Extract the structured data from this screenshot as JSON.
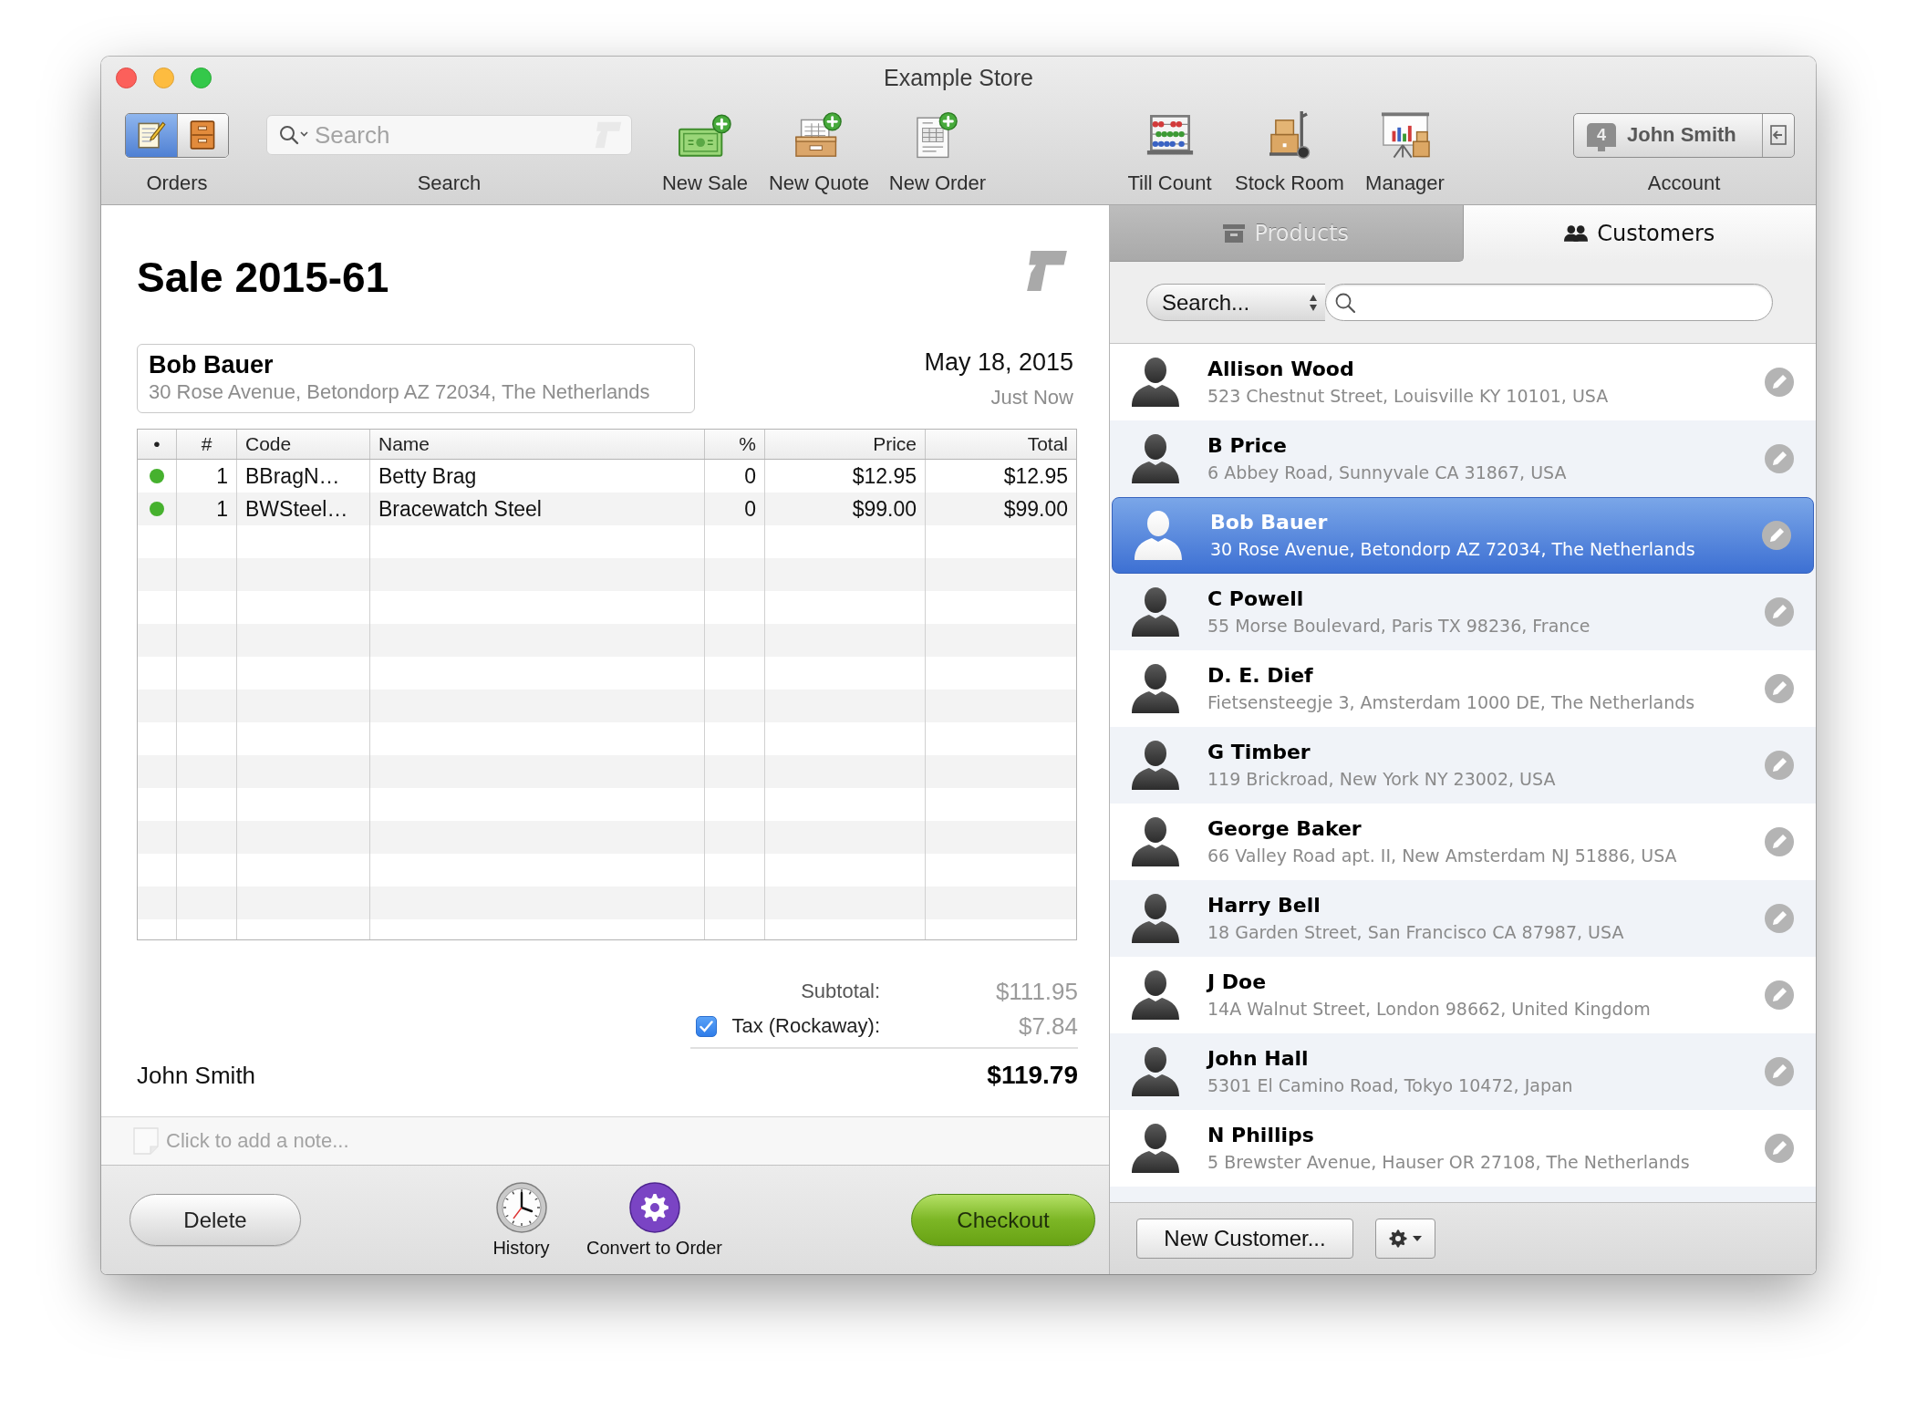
{
  "window": {
    "title": "Example Store"
  },
  "toolbar": {
    "orders": {
      "label": "Orders",
      "segments": [
        {
          "kind": "notepad",
          "selected": true
        },
        {
          "kind": "cabinet",
          "selected": false
        }
      ]
    },
    "search": {
      "placeholder": "Search",
      "label": "Search"
    },
    "actions": [
      {
        "kind": "sale",
        "label": "New Sale"
      },
      {
        "kind": "quote",
        "label": "New Quote"
      },
      {
        "kind": "order",
        "label": "New Order"
      }
    ],
    "tools": [
      {
        "kind": "till",
        "label": "Till Count"
      },
      {
        "kind": "stock",
        "label": "Stock Room"
      },
      {
        "kind": "manager",
        "label": "Manager"
      }
    ],
    "account": {
      "register": "4",
      "name": "John Smith",
      "label": "Account"
    }
  },
  "sale": {
    "title": "Sale 2015-61",
    "customer": {
      "name": "Bob Bauer",
      "address": "30 Rose Avenue, Betondorp AZ 72034, The Netherlands"
    },
    "date": "May 18, 2015",
    "time": "Just Now",
    "table": {
      "columns": [
        "•",
        "#",
        "Code",
        "Name",
        "%",
        "Price",
        "Total"
      ],
      "rows": [
        {
          "color": "#46b12e",
          "cells": [
            "",
            "1",
            "BBragN…",
            "Betty Brag",
            "0",
            "$12.95",
            "$12.95"
          ]
        },
        {
          "color": "#46b12e",
          "cells": [
            "",
            "1",
            "BWSteel…",
            "Bracewatch Steel",
            "0",
            "$99.00",
            "$99.00"
          ]
        }
      ]
    },
    "totals": {
      "subtotal": {
        "label": "Subtotal:",
        "amount": "$111.95"
      },
      "tax": {
        "label": "Tax (Rockaway):",
        "checked": true,
        "amount": "$7.84"
      },
      "total": "$119.79"
    },
    "salesperson": "John Smith",
    "note": {
      "placeholder": "Click to add a note..."
    },
    "footer": {
      "delete": "Delete",
      "actions": [
        {
          "kind": "history",
          "label": "History"
        },
        {
          "kind": "convert",
          "label": "Convert to Order"
        }
      ],
      "checkout": "Checkout"
    }
  },
  "sidebar": {
    "tabs": [
      {
        "kind": "products",
        "label": "Products",
        "selected": false
      },
      {
        "kind": "customers",
        "label": "Customers",
        "selected": true
      }
    ],
    "search": {
      "scope": "Search..."
    },
    "customers": [
      {
        "name": "Allison Wood",
        "address": "523 Chestnut Street, Louisville KY 10101, USA",
        "selected": false
      },
      {
        "name": "B Price",
        "address": "6 Abbey Road, Sunnyvale CA 31867, USA",
        "selected": false
      },
      {
        "name": "Bob Bauer",
        "address": "30 Rose Avenue, Betondorp AZ 72034, The Netherlands",
        "selected": true
      },
      {
        "name": "C Powell",
        "address": "55 Morse Boulevard, Paris TX 98236, France",
        "selected": false
      },
      {
        "name": "D. E. Dief",
        "address": "Fietsensteegje 3, Amsterdam 1000 DE, The Netherlands",
        "selected": false
      },
      {
        "name": "G Timber",
        "address": "119 Brickroad, New York NY 23002, USA",
        "selected": false
      },
      {
        "name": "George Baker",
        "address": "66 Valley Road apt. II, New Amsterdam NJ 51886, USA",
        "selected": false
      },
      {
        "name": "Harry Bell",
        "address": "18 Garden Street, San Francisco CA 87987, USA",
        "selected": false
      },
      {
        "name": "J Doe",
        "address": "14A Walnut Street, London 98662, United Kingdom",
        "selected": false
      },
      {
        "name": "John Hall",
        "address": "5301 El Camino Road, Tokyo 10472, Japan",
        "selected": false
      },
      {
        "name": "N Phillips",
        "address": "5 Brewster Avenue, Hauser OR 27108, The Netherlands",
        "selected": false
      }
    ],
    "footer": {
      "new_customer": "New Customer..."
    }
  }
}
